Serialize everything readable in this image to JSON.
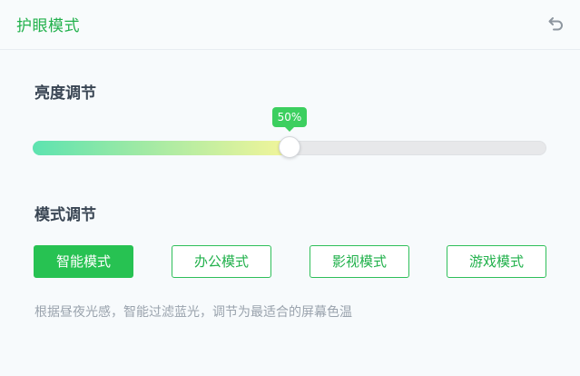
{
  "header": {
    "title": "护眼模式",
    "back_icon": "undo-arrow-icon"
  },
  "brightness": {
    "label": "亮度调节",
    "value_percent": 50,
    "value_text": "50%",
    "gradient_start": "#5de3b0",
    "gradient_end": "#f4f59a"
  },
  "mode": {
    "label": "模式调节",
    "options": [
      {
        "label": "智能模式",
        "active": true
      },
      {
        "label": "办公模式",
        "active": false
      },
      {
        "label": "影视模式",
        "active": false
      },
      {
        "label": "游戏模式",
        "active": false
      }
    ],
    "description": "根据昼夜光感，智能过滤蓝光，调节为最适合的屏幕色温"
  },
  "colors": {
    "accent": "#27c252",
    "text_dark": "#394553",
    "text_muted": "#9aa3ad"
  }
}
